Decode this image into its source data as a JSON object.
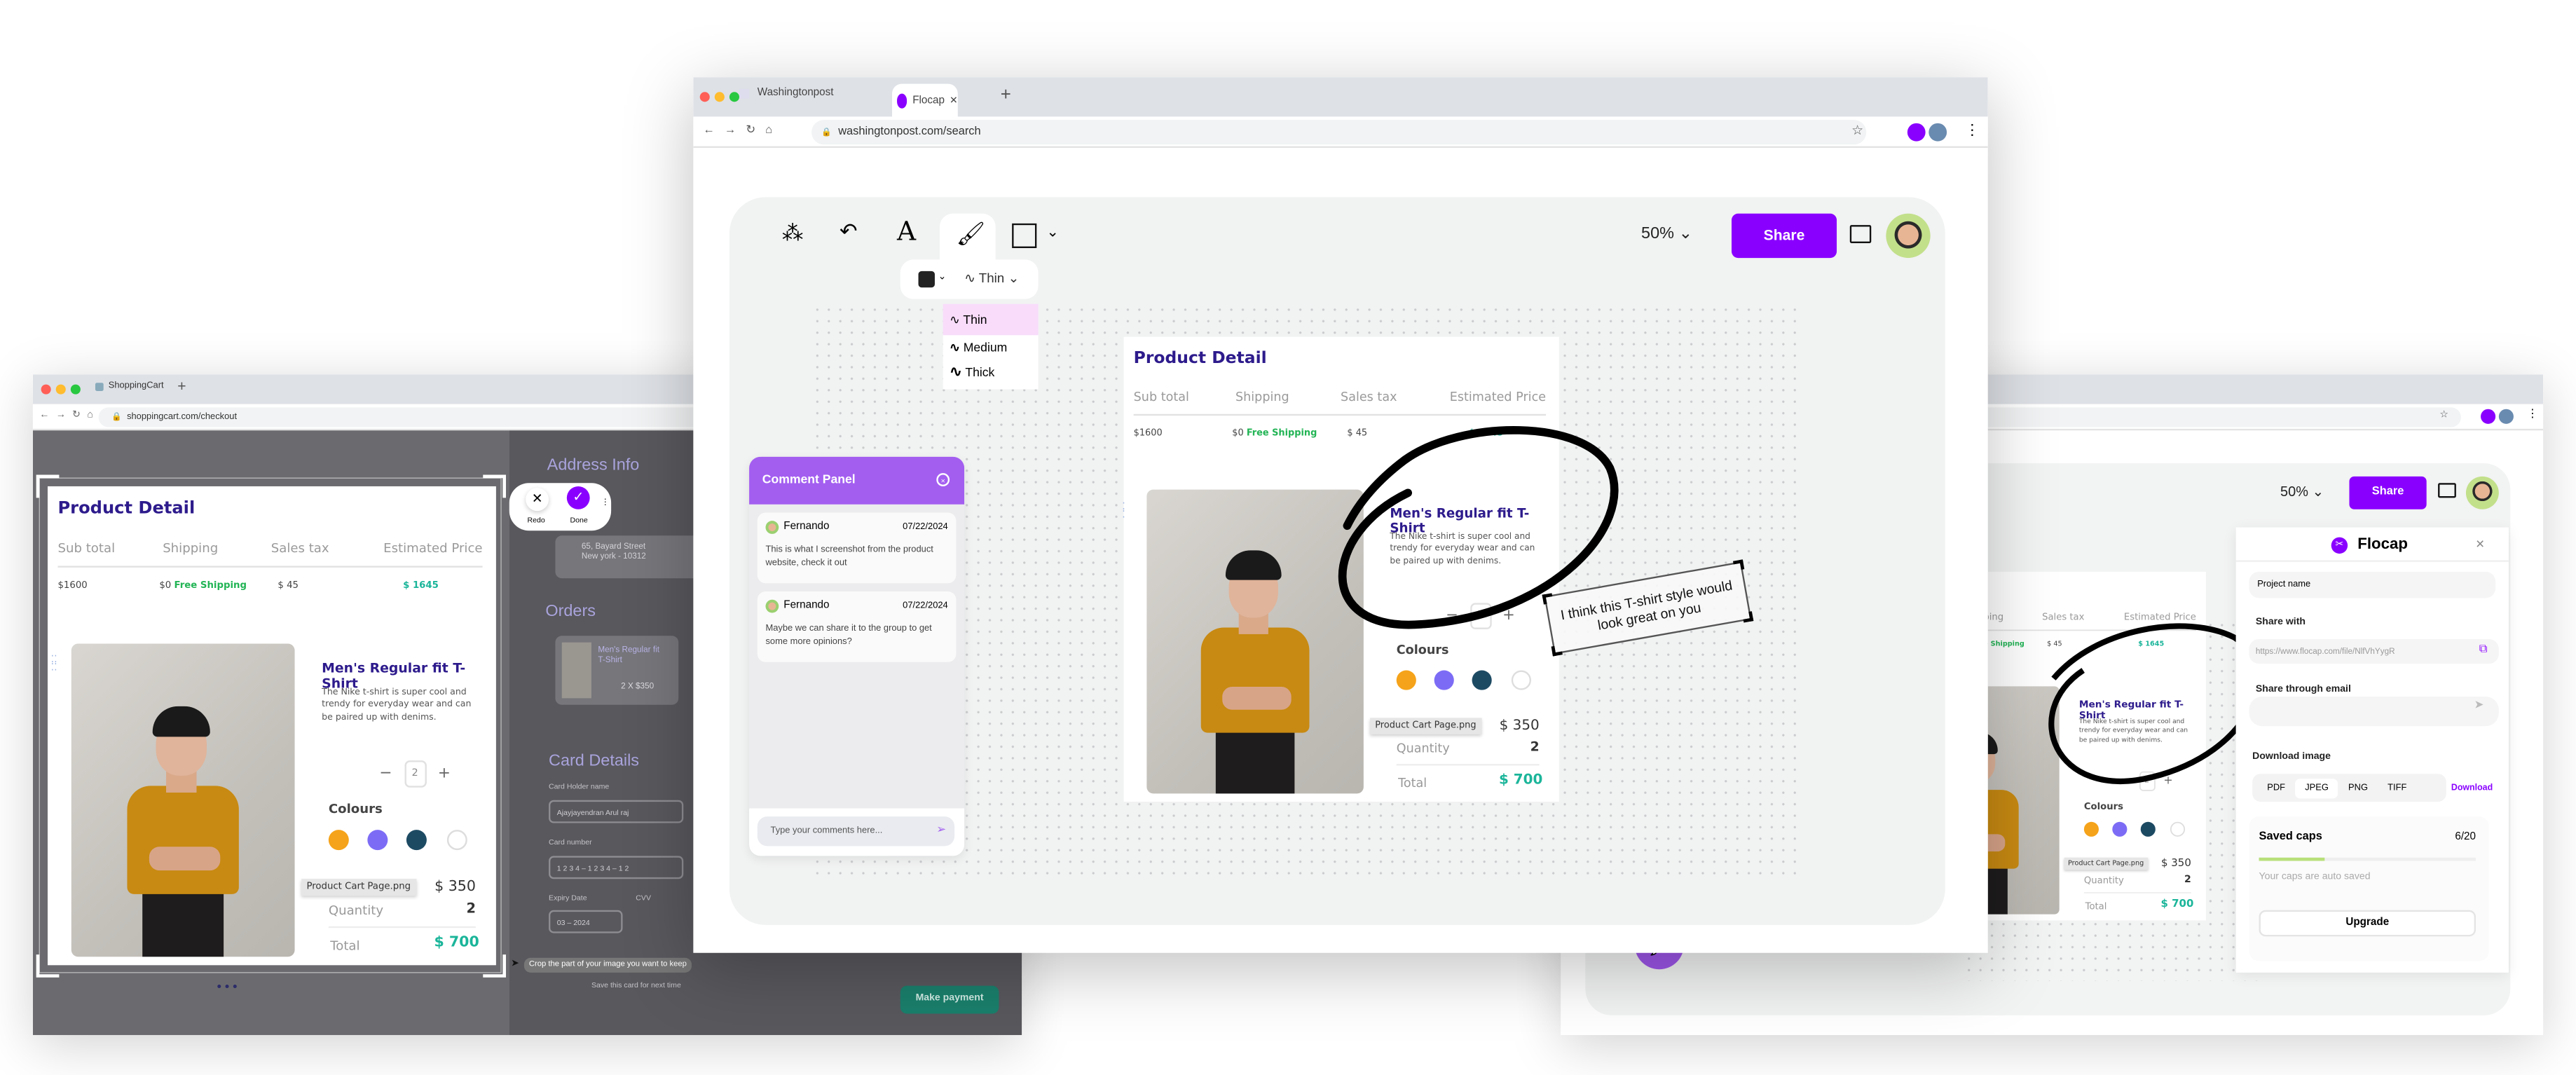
{
  "colors": {
    "brand": "#8a00ff",
    "comment_header": "#a35ef0",
    "teal": "#1bb59a",
    "green": "#22b455",
    "navy": "#2d1b8c"
  },
  "product": {
    "title": "Product Detail",
    "headers": [
      "Sub total",
      "Shipping",
      "Sales tax",
      "Estimated Price"
    ],
    "subtotal": "$1600",
    "shipping_value": "$0",
    "shipping_note": "Free Shipping",
    "sales_tax": "$ 45",
    "estimated": "$ 1645",
    "name": "Men's Regular fit T-Shirt",
    "description": "The Nike t-shirt is super cool and trendy for everyday wear and can be paired up with denims.",
    "stepper_value": "2",
    "stepper_minus": "−",
    "stepper_plus": "+",
    "colours_label": "Colours",
    "swatches": [
      "#f5a31a",
      "#7c6cf5",
      "#1d4a63",
      "#ffffff"
    ],
    "file_tag": "Product Cart Page.png",
    "price": "$ 350",
    "quantity_label": "Quantity",
    "quantity": "2",
    "total_label": "Total",
    "total": "$ 700"
  },
  "left_window": {
    "tab": "ShoppingCart",
    "url": "shoppingcart.com/checkout",
    "crop_toolbar": {
      "redo": "Redo",
      "done": "Done"
    },
    "crop_hint": "Crop the part of your image you want to keep",
    "checkout": {
      "address_title": "Address Info",
      "address_line1": "65, Bayard Street",
      "address_line2": "New york - 10312",
      "orders_title": "Orders",
      "order_item_name": "Men's Regular fit T-Shirt",
      "order_item_qty": "2 X $350",
      "card_title": "Card Details",
      "card_holder_label": "Card Holder name",
      "card_holder_value": "Ajayjayendran Arul raj",
      "card_number_label": "Card number",
      "card_number_value": "1 2 3 4  –  1 2 3 4  –  1 2",
      "expiry_label": "Expiry Date",
      "expiry_value": "03  –  2024",
      "cvv_label": "CVV",
      "save_card": "Save this card for next time",
      "make_payment": "Make payment"
    }
  },
  "center_window": {
    "tabs": [
      {
        "label": "Washingtonpost"
      },
      {
        "label": "Flocap",
        "active": true
      }
    ],
    "url": "washingtonpost.com/search",
    "toolbar": {
      "zoom": "50%",
      "share": "Share"
    },
    "stroke": {
      "selected": "Thin",
      "options": [
        "Thin",
        "Medium",
        "Thick"
      ]
    },
    "comment_panel": {
      "title": "Comment Panel",
      "comments": [
        {
          "author": "Fernando",
          "date": "07/22/2024",
          "text": "This is what I screenshot from the product website, check it out"
        },
        {
          "author": "Fernando",
          "date": "07/22/2024",
          "text": "Maybe we can share it to the group to get some more opinions?"
        }
      ],
      "input_placeholder": "Type your comments here..."
    },
    "note": "I think this T-shirt style would look great on you"
  },
  "right_window": {
    "toolbar": {
      "zoom": "50%",
      "share": "Share"
    },
    "flocap": {
      "title": "Flocap",
      "project_name": "Project name",
      "share_with": "Share with",
      "share_link": "https://www.flocap.com/file/NlfVhYygR",
      "share_email": "Share through email",
      "download_image": "Download image",
      "formats": [
        "PDF",
        "JPEG",
        "PNG",
        "TIFF"
      ],
      "selected_format": "JPEG",
      "download": "Download",
      "saved_caps": "Saved caps",
      "saved_count": "6/20",
      "saved_progress": 0.3,
      "auto_saved": "Your caps are auto saved",
      "upgrade": "Upgrade"
    }
  }
}
